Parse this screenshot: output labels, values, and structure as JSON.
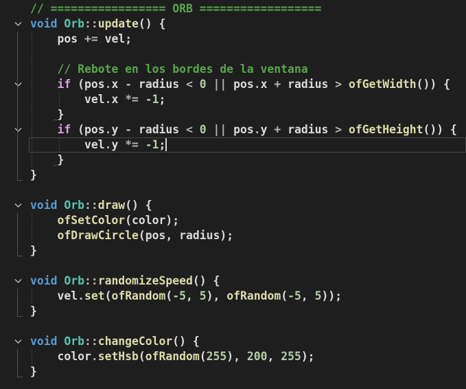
{
  "editor": {
    "colors": {
      "background": "#1e1e1e",
      "keyword": "#569cd6",
      "class": "#4ec9b0",
      "function": "#dcdcaa",
      "variable": "#dadada",
      "control": "#d8a0df",
      "number": "#b5cea8",
      "comment": "#57a64a"
    },
    "cursor_line": 9,
    "lines": [
      {
        "indent": 0,
        "fold": false,
        "tokens": [
          [
            "cm",
            "// ================= ORB =================="
          ]
        ]
      },
      {
        "indent": 0,
        "fold": true,
        "tokens": [
          [
            "kw",
            "void "
          ],
          [
            "cls",
            "Orb"
          ],
          [
            "op",
            "::"
          ],
          [
            "fn",
            "update"
          ],
          [
            "pl",
            "() {"
          ]
        ]
      },
      {
        "indent": 1,
        "fold": false,
        "tokens": [
          [
            "var",
            "pos "
          ],
          [
            "op",
            "+= "
          ],
          [
            "var",
            "vel"
          ],
          [
            "pl",
            ";"
          ]
        ]
      },
      {
        "indent": 0,
        "fold": false,
        "tokens": []
      },
      {
        "indent": 1,
        "fold": false,
        "tokens": [
          [
            "cm",
            "// Rebote en los bordes de la ventana"
          ]
        ]
      },
      {
        "indent": 1,
        "fold": true,
        "tokens": [
          [
            "ctl",
            "if "
          ],
          [
            "pl",
            "("
          ],
          [
            "var",
            "pos"
          ],
          [
            "op",
            "."
          ],
          [
            "var",
            "x "
          ],
          [
            "op",
            "- "
          ],
          [
            "var",
            "radius "
          ],
          [
            "op",
            "< "
          ],
          [
            "num",
            "0 "
          ],
          [
            "op",
            "|| "
          ],
          [
            "var",
            "pos"
          ],
          [
            "op",
            "."
          ],
          [
            "var",
            "x "
          ],
          [
            "op",
            "+ "
          ],
          [
            "var",
            "radius "
          ],
          [
            "op",
            "> "
          ],
          [
            "fn",
            "ofGetWidth"
          ],
          [
            "pl",
            "()) {"
          ]
        ]
      },
      {
        "indent": 2,
        "fold": false,
        "tokens": [
          [
            "var",
            "vel"
          ],
          [
            "op",
            "."
          ],
          [
            "var",
            "x "
          ],
          [
            "op",
            "*= "
          ],
          [
            "num",
            "-1"
          ],
          [
            "pl",
            ";"
          ]
        ]
      },
      {
        "indent": 1,
        "fold": false,
        "tokens": [
          [
            "pl",
            "}"
          ]
        ]
      },
      {
        "indent": 1,
        "fold": true,
        "tokens": [
          [
            "ctl",
            "if "
          ],
          [
            "pl",
            "("
          ],
          [
            "var",
            "pos"
          ],
          [
            "op",
            "."
          ],
          [
            "var",
            "y "
          ],
          [
            "op",
            "- "
          ],
          [
            "var",
            "radius "
          ],
          [
            "op",
            "< "
          ],
          [
            "num",
            "0 "
          ],
          [
            "op",
            "|| "
          ],
          [
            "var",
            "pos"
          ],
          [
            "op",
            "."
          ],
          [
            "var",
            "y "
          ],
          [
            "op",
            "+ "
          ],
          [
            "var",
            "radius "
          ],
          [
            "op",
            "> "
          ],
          [
            "fn",
            "ofGetHeight"
          ],
          [
            "pl",
            "()) {"
          ]
        ]
      },
      {
        "indent": 2,
        "fold": false,
        "tokens": [
          [
            "var",
            "vel"
          ],
          [
            "op",
            "."
          ],
          [
            "var",
            "y "
          ],
          [
            "op",
            "*= "
          ],
          [
            "num",
            "-1"
          ],
          [
            "pl",
            ";"
          ]
        ]
      },
      {
        "indent": 1,
        "fold": false,
        "tokens": [
          [
            "pl",
            "}"
          ]
        ]
      },
      {
        "indent": 0,
        "fold": false,
        "tokens": [
          [
            "pl",
            "}"
          ]
        ]
      },
      {
        "indent": 0,
        "fold": false,
        "tokens": []
      },
      {
        "indent": 0,
        "fold": true,
        "tokens": [
          [
            "kw",
            "void "
          ],
          [
            "cls",
            "Orb"
          ],
          [
            "op",
            "::"
          ],
          [
            "fn",
            "draw"
          ],
          [
            "pl",
            "() {"
          ]
        ]
      },
      {
        "indent": 1,
        "fold": false,
        "tokens": [
          [
            "fn",
            "ofSetColor"
          ],
          [
            "pl",
            "("
          ],
          [
            "var",
            "color"
          ],
          [
            "pl",
            ");"
          ]
        ]
      },
      {
        "indent": 1,
        "fold": false,
        "tokens": [
          [
            "fn",
            "ofDrawCircle"
          ],
          [
            "pl",
            "("
          ],
          [
            "var",
            "pos"
          ],
          [
            "pl",
            ", "
          ],
          [
            "var",
            "radius"
          ],
          [
            "pl",
            ");"
          ]
        ]
      },
      {
        "indent": 0,
        "fold": false,
        "tokens": [
          [
            "pl",
            "}"
          ]
        ]
      },
      {
        "indent": 0,
        "fold": false,
        "tokens": []
      },
      {
        "indent": 0,
        "fold": true,
        "tokens": [
          [
            "kw",
            "void "
          ],
          [
            "cls",
            "Orb"
          ],
          [
            "op",
            "::"
          ],
          [
            "fn",
            "randomizeSpeed"
          ],
          [
            "pl",
            "() {"
          ]
        ]
      },
      {
        "indent": 1,
        "fold": false,
        "tokens": [
          [
            "var",
            "vel"
          ],
          [
            "op",
            "."
          ],
          [
            "fn",
            "set"
          ],
          [
            "pl",
            "("
          ],
          [
            "fn",
            "ofRandom"
          ],
          [
            "pl",
            "("
          ],
          [
            "num",
            "-5"
          ],
          [
            "pl",
            ", "
          ],
          [
            "num",
            "5"
          ],
          [
            "pl",
            "), "
          ],
          [
            "fn",
            "ofRandom"
          ],
          [
            "pl",
            "("
          ],
          [
            "num",
            "-5"
          ],
          [
            "pl",
            ", "
          ],
          [
            "num",
            "5"
          ],
          [
            "pl",
            "));"
          ]
        ]
      },
      {
        "indent": 0,
        "fold": false,
        "tokens": [
          [
            "pl",
            "}"
          ]
        ]
      },
      {
        "indent": 0,
        "fold": false,
        "tokens": []
      },
      {
        "indent": 0,
        "fold": true,
        "tokens": [
          [
            "kw",
            "void "
          ],
          [
            "cls",
            "Orb"
          ],
          [
            "op",
            "::"
          ],
          [
            "fn",
            "changeColor"
          ],
          [
            "pl",
            "() {"
          ]
        ]
      },
      {
        "indent": 1,
        "fold": false,
        "tokens": [
          [
            "var",
            "color"
          ],
          [
            "op",
            "."
          ],
          [
            "fn",
            "setHsb"
          ],
          [
            "pl",
            "("
          ],
          [
            "fn",
            "ofRandom"
          ],
          [
            "pl",
            "("
          ],
          [
            "num",
            "255"
          ],
          [
            "pl",
            "), "
          ],
          [
            "num",
            "200"
          ],
          [
            "pl",
            ", "
          ],
          [
            "num",
            "255"
          ],
          [
            "pl",
            ");"
          ]
        ]
      },
      {
        "indent": 0,
        "fold": false,
        "tokens": [
          [
            "pl",
            "}"
          ]
        ]
      }
    ]
  }
}
